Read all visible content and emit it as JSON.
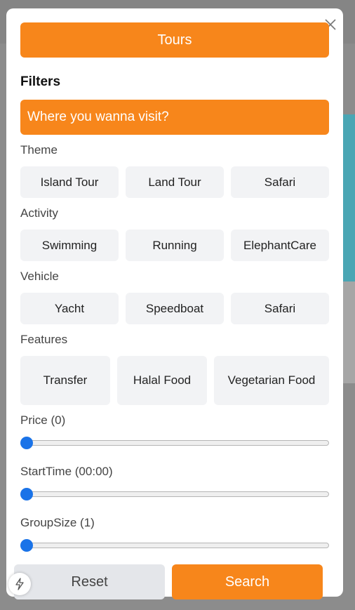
{
  "modal": {
    "title": "Tours",
    "heading": "Filters",
    "search_placeholder": "Where you wanna visit?"
  },
  "theme": {
    "label": "Theme",
    "options": [
      "Island Tour",
      "Land Tour",
      "Safari"
    ]
  },
  "activity": {
    "label": "Activity",
    "options": [
      "Swimming",
      "Running",
      "ElephantCare"
    ]
  },
  "vehicle": {
    "label": "Vehicle",
    "options": [
      "Yacht",
      "Speedboat",
      "Safari"
    ]
  },
  "features": {
    "label": "Features",
    "options": [
      "Transfer",
      "Halal Food",
      "Vegetarian Food"
    ]
  },
  "price": {
    "label": "Price (0)",
    "value": 0
  },
  "start_time": {
    "label": "StartTime (00:00)",
    "value": 0
  },
  "group_size": {
    "label": "GroupSize (1)",
    "value": 0
  },
  "actions": {
    "reset_label": "Reset",
    "search_label": "Search"
  },
  "colors": {
    "accent": "#f7861b",
    "slider_thumb": "#1a73e8",
    "chip_bg": "#f2f3f5"
  },
  "icons": {
    "close": "close-icon",
    "fab": "lightning-icon"
  }
}
